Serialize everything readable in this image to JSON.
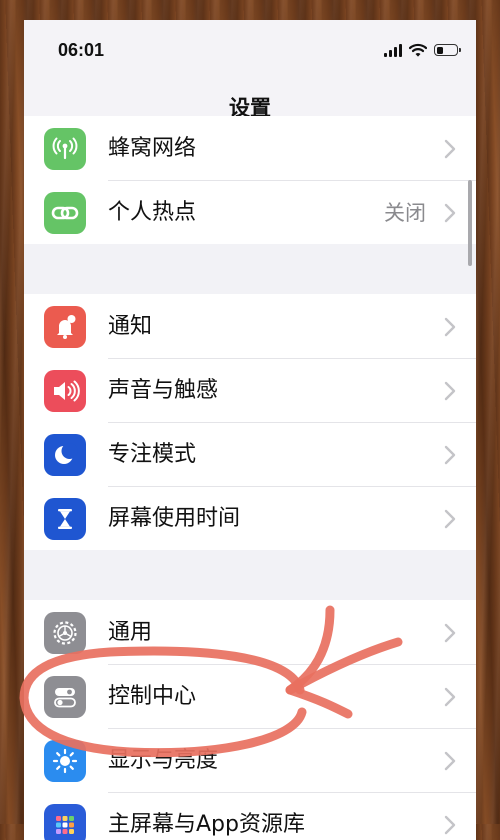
{
  "status": {
    "time": "06:01"
  },
  "nav": {
    "title": "设置"
  },
  "groups": [
    {
      "items": [
        {
          "label": "蜂窝网络",
          "icon": "cellular-antenna-icon",
          "color": "#65c466"
        },
        {
          "label": "个人热点",
          "value": "关闭",
          "icon": "hotspot-link-icon",
          "color": "#65c466"
        }
      ]
    },
    {
      "items": [
        {
          "label": "通知",
          "icon": "bell-icon",
          "color": "#eb5b4f"
        },
        {
          "label": "声音与触感",
          "icon": "speaker-icon",
          "color": "#ec4d5b"
        },
        {
          "label": "专注模式",
          "icon": "moon-icon",
          "color": "#1f56d1"
        },
        {
          "label": "屏幕使用时间",
          "icon": "hourglass-icon",
          "color": "#1f56d1"
        }
      ]
    },
    {
      "items": [
        {
          "label": "通用",
          "icon": "gear-icon",
          "color": "#8e8e93"
        },
        {
          "label": "控制中心",
          "icon": "toggles-icon",
          "color": "#8e8e93"
        },
        {
          "label": "显示与亮度",
          "icon": "sun-icon",
          "color": "#2b8cef"
        },
        {
          "label": "主屏幕与App资源库",
          "icon": "home-grid-icon",
          "color": "#2a5cd8"
        }
      ]
    }
  ],
  "annotation": {
    "color": "#e8705f"
  },
  "colors": {
    "background": "#f2f2f6",
    "row": "#ffffff",
    "chevron": "#c4c4c8",
    "secondary_text": "#8a8a8e"
  }
}
